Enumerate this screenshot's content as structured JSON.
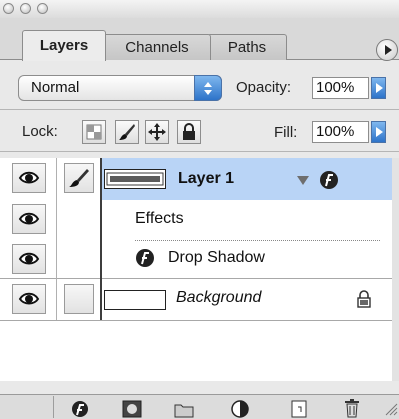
{
  "tabs": [
    {
      "label": "Layers",
      "active": true
    },
    {
      "label": "Channels",
      "active": false
    },
    {
      "label": "Paths",
      "active": false
    }
  ],
  "blend": {
    "mode": "Normal"
  },
  "opacity": {
    "label": "Opacity:",
    "value": "100%"
  },
  "lock": {
    "label": "Lock:"
  },
  "fill": {
    "label": "Fill:",
    "value": "100%"
  },
  "layers": {
    "layer1": {
      "name": "Layer 1",
      "selected": true
    },
    "effects": {
      "label": "Effects"
    },
    "drop_shadow": {
      "label": "Drop Shadow"
    },
    "background": {
      "name": "Background",
      "locked": true
    }
  },
  "colors": {
    "selection": "#b9d4f6",
    "accent": "#2d73c9"
  },
  "icons": {
    "visibility": "eye-icon",
    "link": "brush-icon",
    "effects": "fx-icon",
    "lock": "lock-icon"
  }
}
